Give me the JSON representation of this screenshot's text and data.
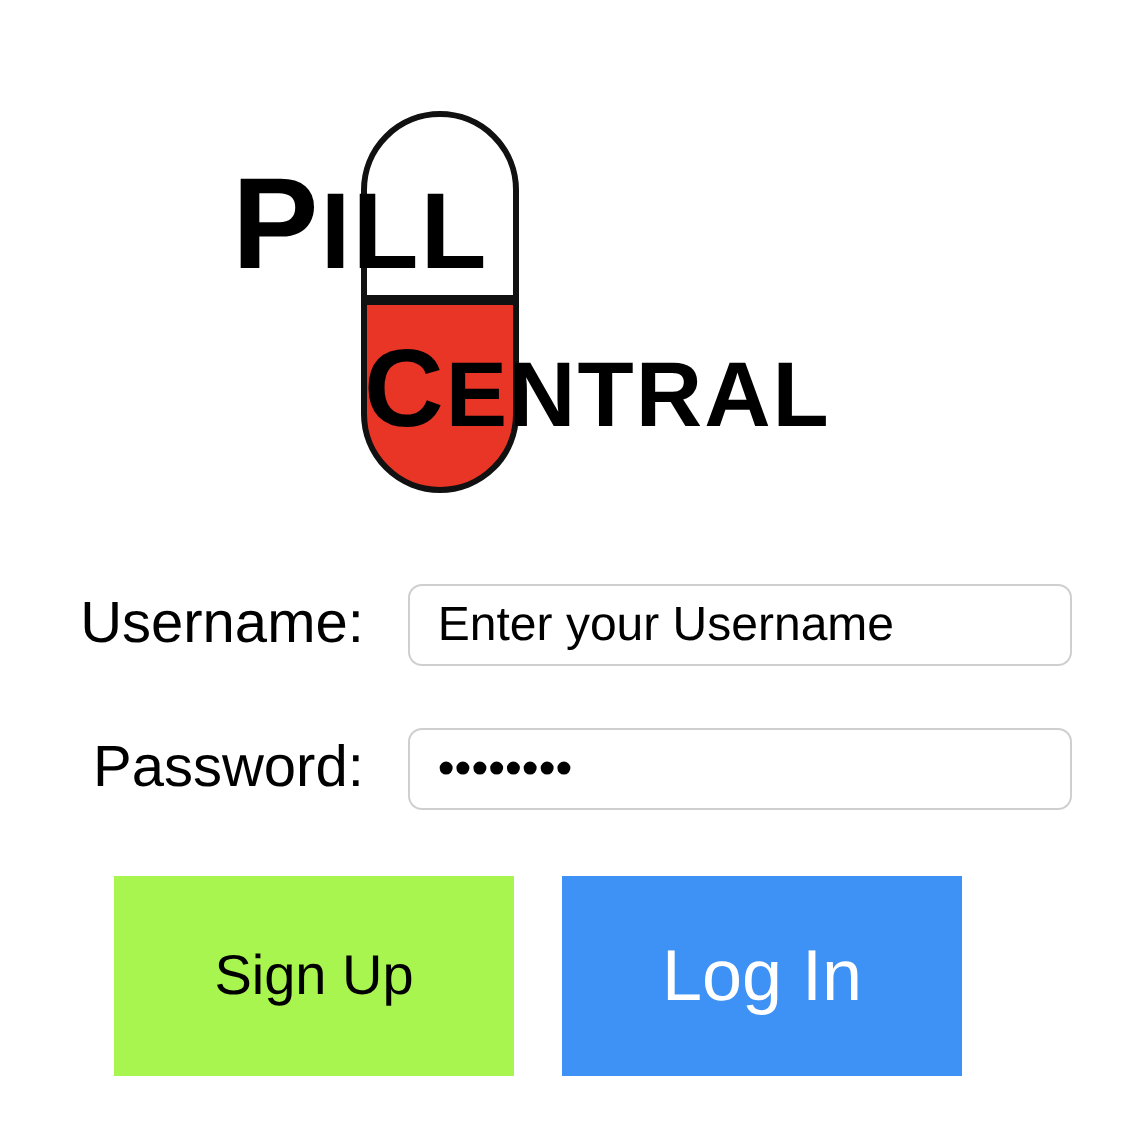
{
  "logo": {
    "lines": [
      "PILL",
      "CENTRAL"
    ]
  },
  "fields": [
    {
      "label": "Username:",
      "value": "Enter your Username"
    },
    {
      "label": "Password:",
      "value": "••••••••"
    }
  ],
  "buttons": [
    {
      "label": "Sign Up",
      "color": "#a9f54f"
    },
    {
      "label": "Log In",
      "color": "#3f92f5"
    }
  ]
}
